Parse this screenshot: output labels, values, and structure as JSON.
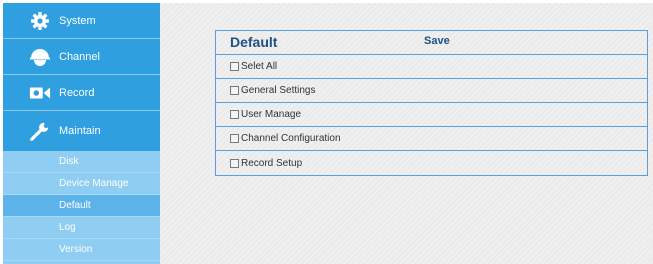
{
  "sidebar": {
    "items": [
      {
        "label": "System",
        "icon": "gear-icon"
      },
      {
        "label": "Channel",
        "icon": "dome-camera-icon"
      },
      {
        "label": "Record",
        "icon": "video-camera-icon"
      },
      {
        "label": "Maintain",
        "icon": "wrench-icon"
      }
    ],
    "submenu": [
      {
        "label": "Disk"
      },
      {
        "label": "Device Manage"
      },
      {
        "label": "Default",
        "active": true
      },
      {
        "label": "Log"
      },
      {
        "label": "Version"
      }
    ]
  },
  "panel": {
    "title": "Default",
    "save_label": "Save",
    "options": [
      {
        "label": "Selet All",
        "checked": false
      },
      {
        "label": "General Settings",
        "checked": false
      },
      {
        "label": "User Manage",
        "checked": false
      },
      {
        "label": "Channel Configuration",
        "checked": false
      },
      {
        "label": "Record Setup",
        "checked": false
      }
    ]
  },
  "colors": {
    "sidebar": "#2f9fe0",
    "submenu": "#8fcdf2",
    "submenu_active": "#5cb3ea",
    "panel_border": "#5a9fd8",
    "title_text": "#1f4f86"
  }
}
